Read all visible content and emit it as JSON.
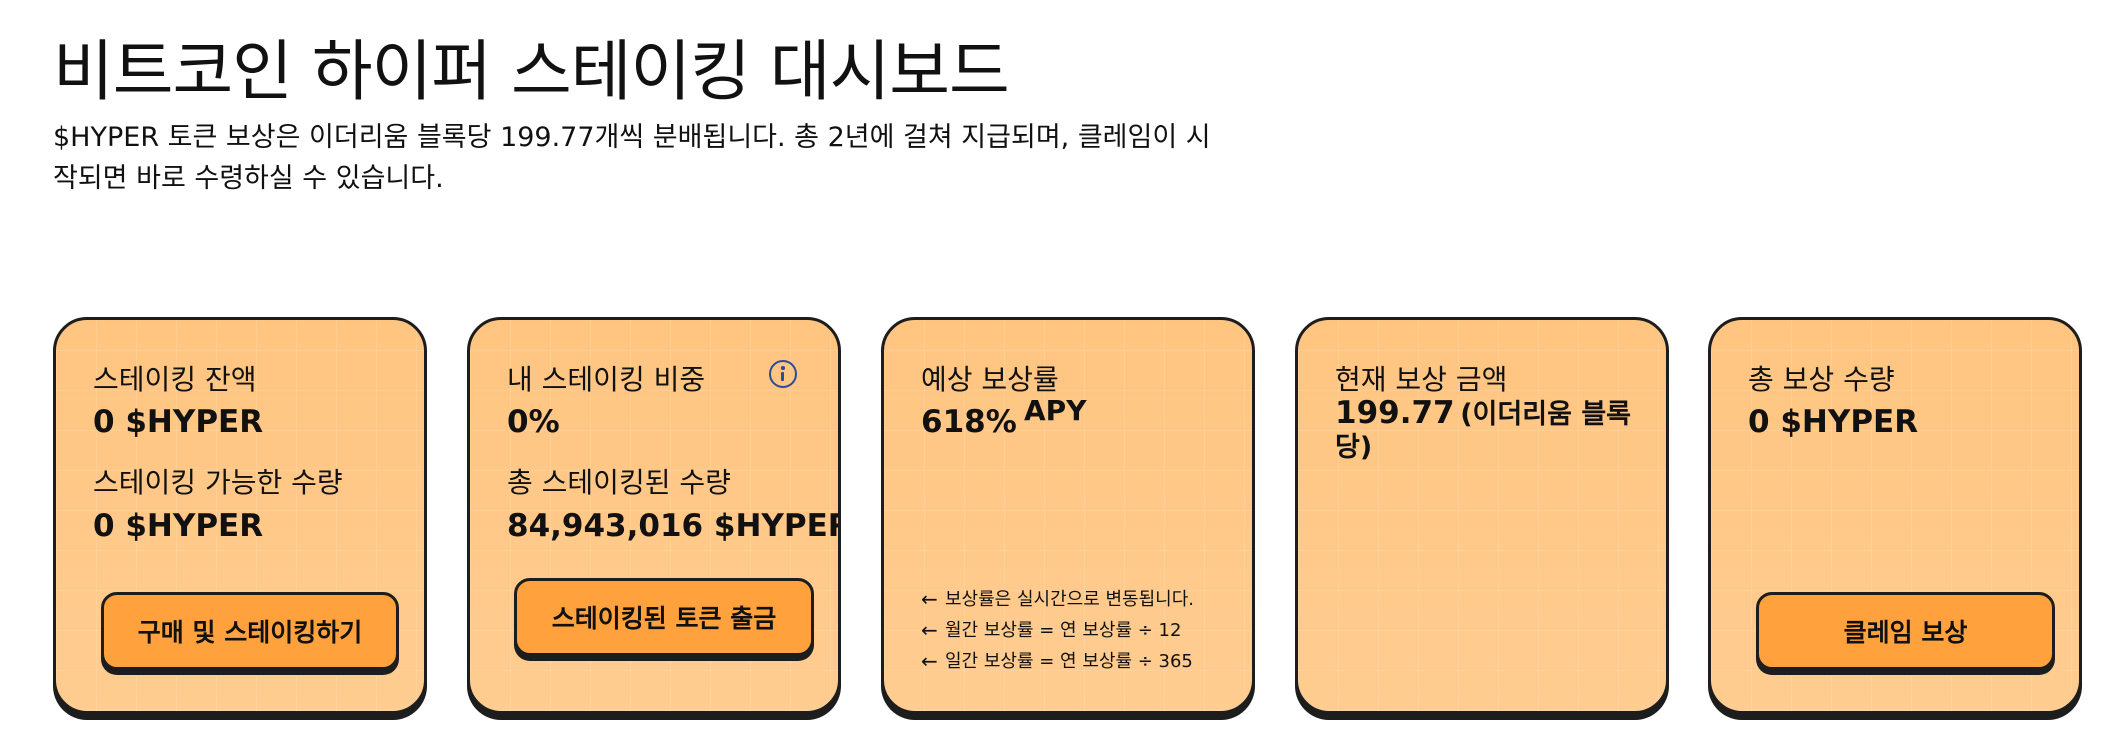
{
  "page": {
    "title": "비트코인 하이퍼 스테이킹 대시보드",
    "subtitle": "$HYPER 토큰 보상은 이더리움 블록당 199.77개씩 분배됩니다. 총 2년에 걸쳐 지급되며, 클레임이 시작되면 바로 수령하실 수 있습니다."
  },
  "cards": {
    "staking_balance": {
      "label": "스테이킹 잔액",
      "value": "0 $HYPER",
      "stakeable_label": "스테이킹 가능한 수량",
      "stakeable_value": "0 $HYPER",
      "button": "구매 및 스테이킹하기"
    },
    "my_share": {
      "label": "내 스테이킹 비중",
      "value": "0%",
      "total_label": "총 스테이킹된 수량",
      "total_value": "84,943,016 $HYPER",
      "button": "스테이킹된 토큰 출금",
      "icon": "info-icon"
    },
    "expected_rate": {
      "label": "예상 보상률",
      "value": "618%",
      "unit": "APY",
      "arrow": "←",
      "notes": [
        "보상률은 실시간으로 변동됩니다.",
        "월간 보상률 = 연 보상률 ÷ 12",
        "일간 보상률 = 연 보상률 ÷ 365"
      ]
    },
    "current_reward": {
      "label": "현재 보상 금액",
      "value": "199.77",
      "unit": "(이더리움 블록당)"
    },
    "total_reward": {
      "label": "총 보상 수량",
      "value": "0 $HYPER",
      "button": "클레임 보상"
    }
  },
  "colors": {
    "card_bg": "#ffbe72",
    "button_bg": "#ffa13d",
    "border": "#1d1d1d",
    "info_icon": "#2b4c9b"
  }
}
